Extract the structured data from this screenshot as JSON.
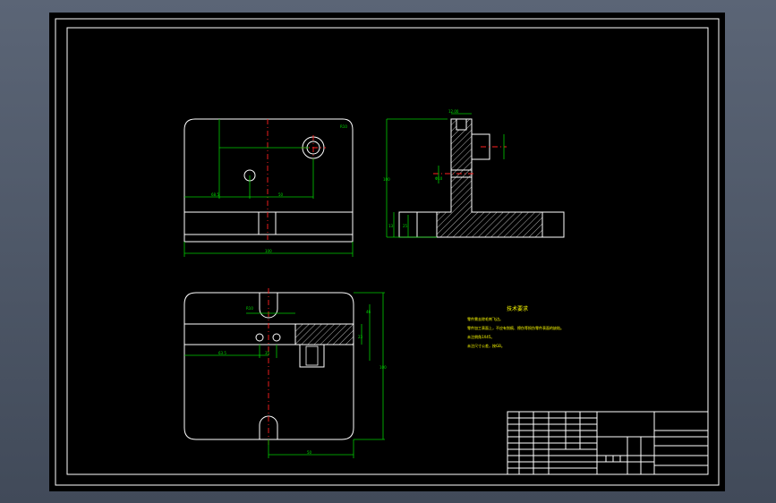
{
  "notes": {
    "title": "技术要求",
    "lines": [
      "零件需去除毛刺飞边。",
      "零件加工表面上，不应有划痕、擦伤等损伤零件表面的缺陷。",
      "未注倒角1X45。",
      "未注尺寸公差，按GB。"
    ]
  },
  "colors": {
    "outline": "#ffffff",
    "dimension": "#00cc00",
    "centerline": "#ff2020",
    "text": "#ffff00"
  }
}
